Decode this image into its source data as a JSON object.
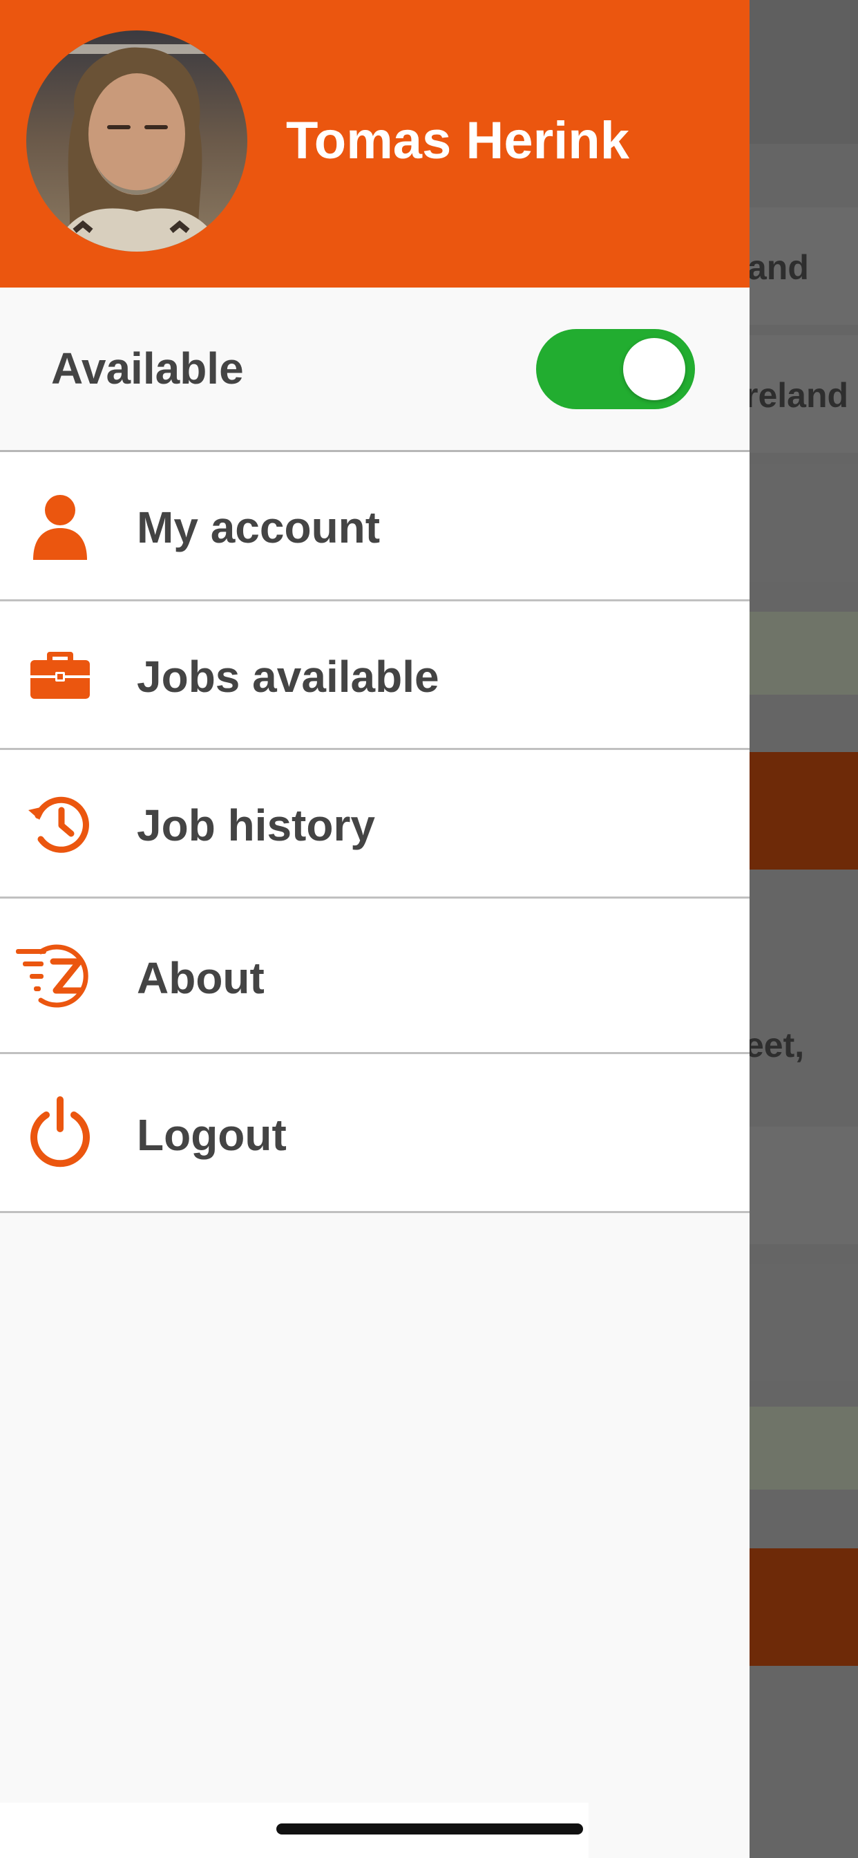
{
  "background": {
    "fragments": [
      "and",
      "reland",
      "eet,"
    ]
  },
  "user": {
    "name": "Tomas Herink",
    "avatar_icon": "user-photo"
  },
  "availability": {
    "label": "Available",
    "enabled": true
  },
  "menu": {
    "items": [
      {
        "label": "My account",
        "icon": "person-icon"
      },
      {
        "label": "Jobs available",
        "icon": "briefcase-icon"
      },
      {
        "label": "Job history",
        "icon": "history-icon"
      },
      {
        "label": "About",
        "icon": "z-logo-icon"
      },
      {
        "label": "Logout",
        "icon": "power-icon"
      }
    ]
  },
  "colors": {
    "accent": "#eb560f",
    "toggle_on": "#22ad30",
    "text": "#444444"
  }
}
